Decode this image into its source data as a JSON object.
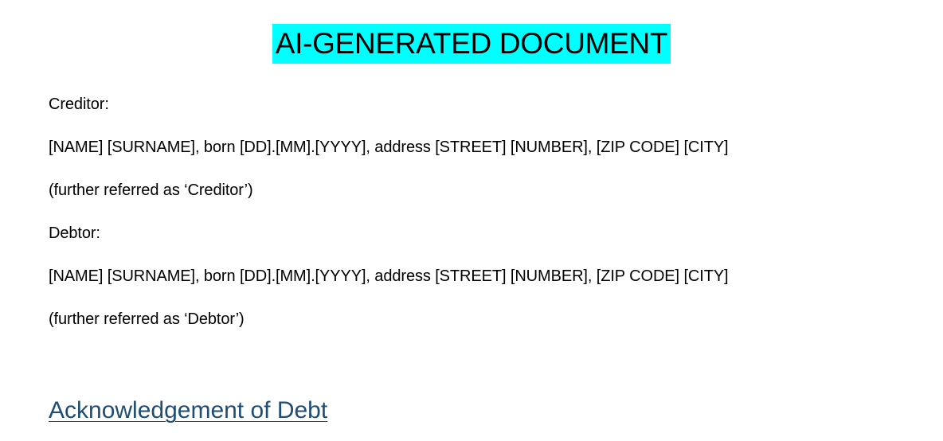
{
  "title_banner": "AI-GENERATED DOCUMENT",
  "creditor": {
    "label": "Creditor:",
    "details": "[NAME] [SURNAME], born [DD].[MM].[YYYY], address [STREET] [NUMBER], [ZIP CODE] [CITY]",
    "referred": "(further referred as ‘Creditor’)"
  },
  "debtor": {
    "label": "Debtor:",
    "details": "[NAME] [SURNAME], born [DD].[MM].[YYYY], address [STREET] [NUMBER], [ZIP CODE] [CITY]",
    "referred": "(further referred as ‘Debtor’)"
  },
  "section_heading": "Acknowledgement of Debt",
  "colors": {
    "banner_highlight": "#00ffff",
    "heading": "#1f4d73"
  }
}
